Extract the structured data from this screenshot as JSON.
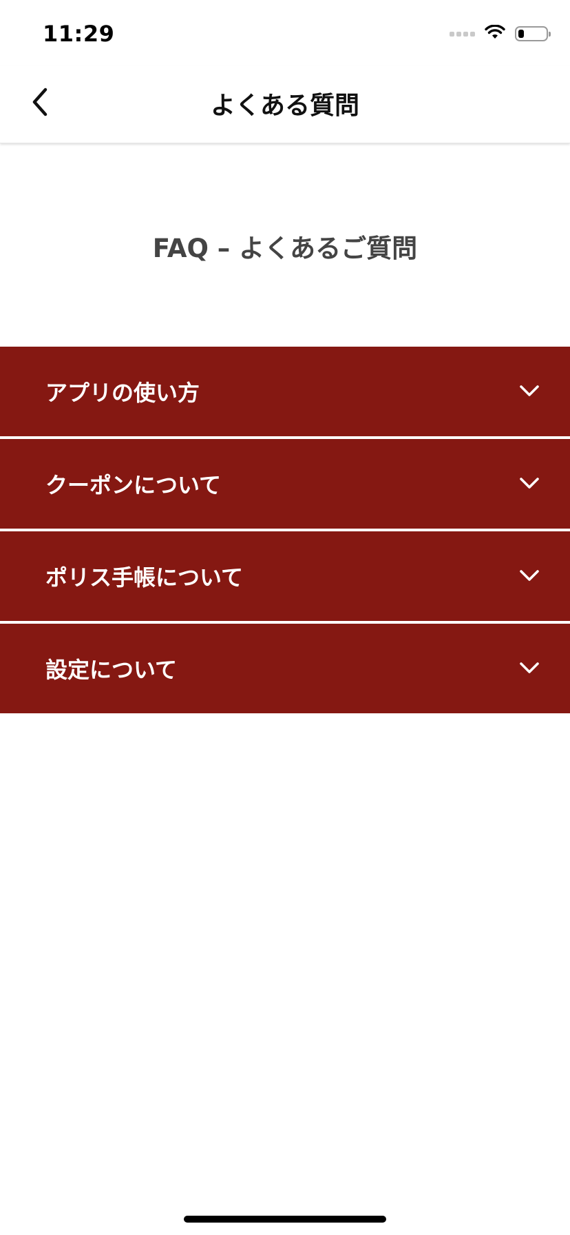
{
  "status_bar": {
    "time": "11:29",
    "wifi_icon": "wifi-icon",
    "battery_icon": "battery-icon",
    "battery_level": 0.2
  },
  "nav": {
    "back_icon": "chevron-left-icon",
    "title": "よくある質問"
  },
  "main": {
    "heading": "FAQ – よくあるご質問",
    "accordion_color": "#851812",
    "sections": [
      {
        "label": "アプリの使い方",
        "icon": "chevron-down-icon"
      },
      {
        "label": "クーポンについて",
        "icon": "chevron-down-icon"
      },
      {
        "label": "ポリス手帳について",
        "icon": "chevron-down-icon"
      },
      {
        "label": "設定について",
        "icon": "chevron-down-icon"
      }
    ]
  }
}
